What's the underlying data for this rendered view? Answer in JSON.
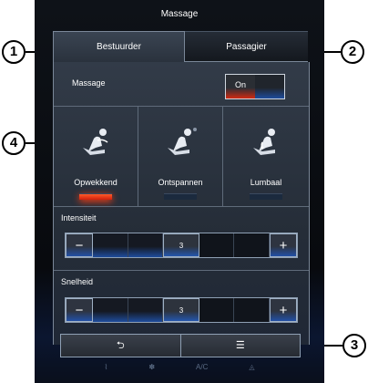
{
  "header": {
    "title": "Massage"
  },
  "tabs": [
    {
      "label": "Bestuurder"
    },
    {
      "label": "Passagier"
    }
  ],
  "massage_row": {
    "label": "Massage",
    "toggle_on_label": "On"
  },
  "modes": [
    {
      "label": "Opwekkend",
      "active": true
    },
    {
      "label": "Ontspannen",
      "active": false
    },
    {
      "label": "Lumbaal",
      "active": false
    }
  ],
  "intensity": {
    "label": "Intensiteit",
    "value": "3",
    "minus": "−",
    "plus": "+"
  },
  "speed": {
    "label": "Snelheid",
    "value": "3",
    "minus": "−",
    "plus": "+"
  },
  "bottom": {
    "back_icon": "back-arrow-icon",
    "menu_icon": "menu-list-icon",
    "back_glyph": "⮌",
    "menu_glyph": "☰"
  },
  "climate": {
    "ac_label": "A/C"
  },
  "callouts": [
    "1",
    "2",
    "3",
    "4"
  ],
  "colors": {
    "accent_red": "#d3200c",
    "accent_blue": "#1e4c9c"
  }
}
